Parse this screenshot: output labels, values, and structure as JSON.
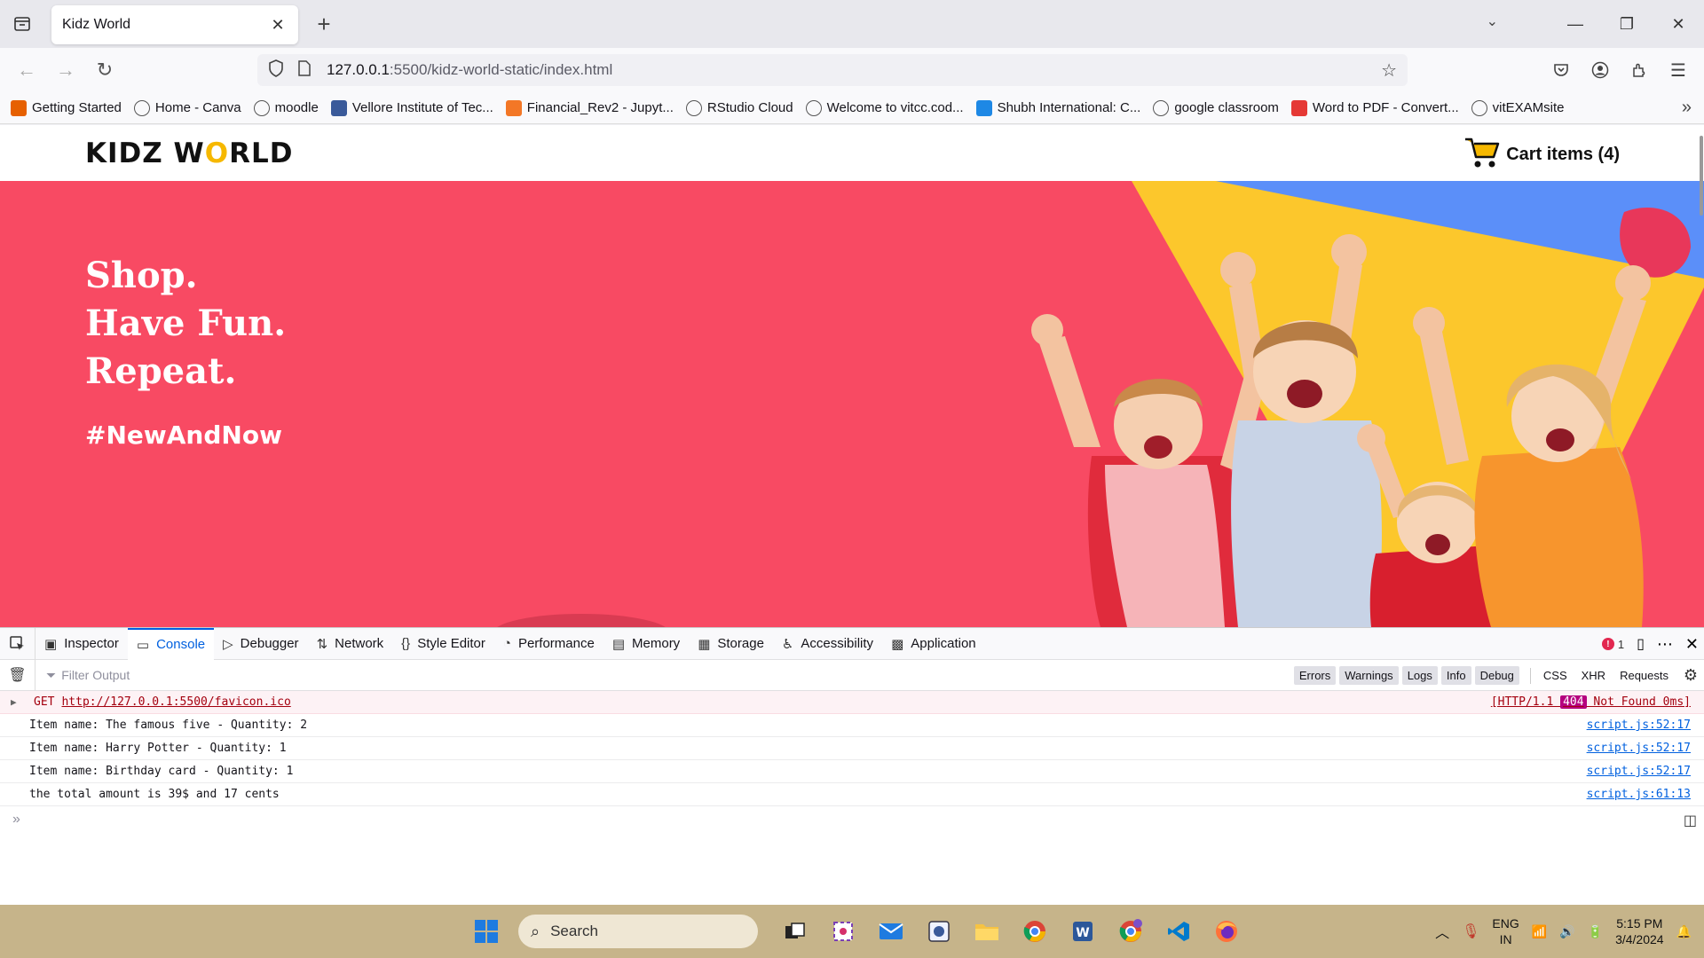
{
  "browser": {
    "tab_title": "Kidz World",
    "new_tab": "+",
    "url_host": "127.0.0.1",
    "url_path": ":5500/kidz-world-static/index.html",
    "bookmarks": [
      {
        "label": "Getting Started",
        "icon": "firefox-icon",
        "color": "#e66000"
      },
      {
        "label": "Home - Canva",
        "icon": "globe-icon",
        "color": "#555555"
      },
      {
        "label": "moodle",
        "icon": "globe-icon",
        "color": "#555555"
      },
      {
        "label": "Vellore Institute of Tec...",
        "icon": "vit-icon",
        "color": "#3a5a9a"
      },
      {
        "label": "Financial_Rev2 - Jupyt...",
        "icon": "jupyter-icon",
        "color": "#f37726"
      },
      {
        "label": "RStudio Cloud",
        "icon": "globe-icon",
        "color": "#555555"
      },
      {
        "label": "Welcome to vitcc.cod...",
        "icon": "globe-icon",
        "color": "#555555"
      },
      {
        "label": "Shubh International: C...",
        "icon": "is-icon",
        "color": "#1e88e5"
      },
      {
        "label": "google classroom",
        "icon": "globe-icon",
        "color": "#555555"
      },
      {
        "label": "Word to PDF - Convert...",
        "icon": "ilovepdf-icon",
        "color": "#e53935"
      },
      {
        "label": "vitEXAMsite",
        "icon": "globe-icon",
        "color": "#555555"
      }
    ]
  },
  "site": {
    "logo_pre": "KIDZ W",
    "logo_o": "O",
    "logo_post": "RLD",
    "cart_label": "Cart items (4)",
    "hero_lines": [
      "Shop.",
      "Have Fun.",
      "Repeat."
    ],
    "hero_tag": "#NewAndNow",
    "colors": {
      "hero_bg": "#f84a63",
      "yellow": "#fcc72c",
      "blue": "#5b8ff9"
    }
  },
  "devtools": {
    "tabs": [
      {
        "label": "Inspector",
        "icon": "inspector-icon"
      },
      {
        "label": "Console",
        "icon": "console-icon",
        "active": true
      },
      {
        "label": "Debugger",
        "icon": "debugger-icon"
      },
      {
        "label": "Network",
        "icon": "network-icon"
      },
      {
        "label": "Style Editor",
        "icon": "style-editor-icon"
      },
      {
        "label": "Performance",
        "icon": "performance-icon"
      },
      {
        "label": "Memory",
        "icon": "memory-icon"
      },
      {
        "label": "Storage",
        "icon": "storage-icon"
      },
      {
        "label": "Accessibility",
        "icon": "accessibility-icon"
      },
      {
        "label": "Application",
        "icon": "application-icon"
      }
    ],
    "error_count": "1",
    "filter_placeholder": "Filter Output",
    "filter_buttons": [
      "Errors",
      "Warnings",
      "Logs",
      "Info",
      "Debug"
    ],
    "filter_buttons_2": [
      "CSS",
      "XHR",
      "Requests"
    ],
    "error_row": {
      "method": "GET",
      "url": "http://127.0.0.1:5500/favicon.ico",
      "status_pre": "[HTTP/1.1 ",
      "status_code": "404",
      "status_post": " Not Found 0ms]"
    },
    "logs": [
      {
        "text": "Item name: The famous five - Quantity: 2",
        "source": "script.js:52:17"
      },
      {
        "text": "Item name: Harry Potter - Quantity: 1",
        "source": "script.js:52:17"
      },
      {
        "text": "Item name: Birthday card - Quantity: 1",
        "source": "script.js:52:17"
      },
      {
        "text": "the total amount is 39$ and 17 cents",
        "source": "script.js:61:13"
      }
    ],
    "prompt": "»"
  },
  "taskbar": {
    "search_label": "Search",
    "lang_1": "ENG",
    "lang_2": "IN",
    "time": "5:15 PM",
    "date": "3/4/2024"
  }
}
